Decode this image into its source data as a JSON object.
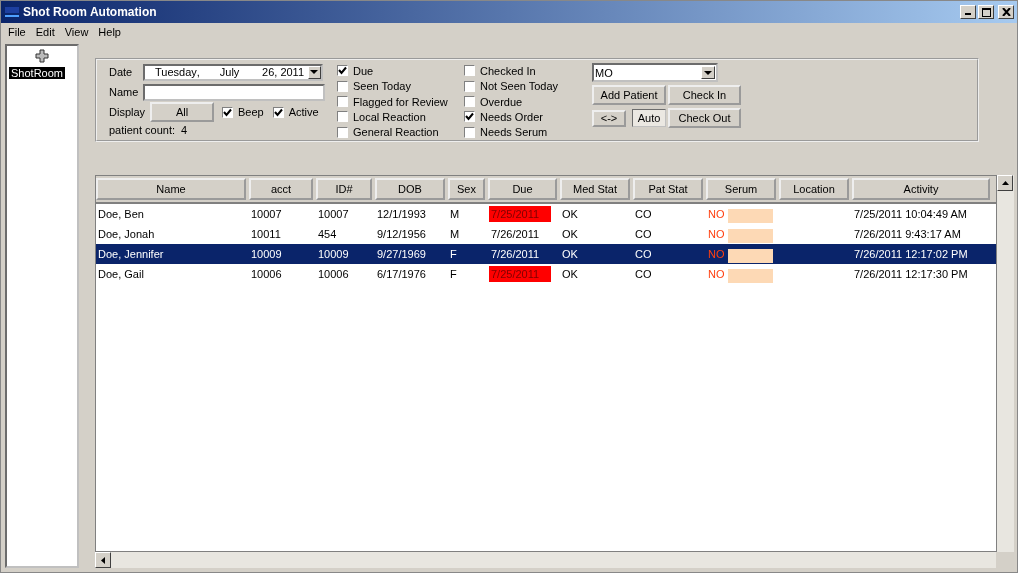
{
  "window": {
    "title": "Shot Room Automation"
  },
  "menu": [
    "File",
    "Edit",
    "View",
    "Help"
  ],
  "sidebar": {
    "items": [
      {
        "label": "ShotRoom",
        "selected": true
      }
    ]
  },
  "filters": {
    "date": {
      "label": "Date",
      "weekday": "Tuesday",
      "separator": ",",
      "month": "July",
      "day_year": "26, 2011"
    },
    "name": {
      "label": "Name"
    },
    "display": {
      "label": "Display",
      "button": "All"
    },
    "beep": {
      "label": "Beep",
      "checked": true
    },
    "active": {
      "label": "Active",
      "checked": true
    },
    "patient_count": {
      "label": "patient count:",
      "value": "4"
    },
    "checkbox_columns": [
      [
        {
          "label": "Due",
          "checked": true
        },
        {
          "label": "Seen Today",
          "checked": false
        },
        {
          "label": "Flagged for Review",
          "checked": false
        },
        {
          "label": "Local Reaction",
          "checked": false
        },
        {
          "label": "General Reaction",
          "checked": false
        }
      ],
      [
        {
          "label": "Checked In",
          "checked": false
        },
        {
          "label": "Not Seen Today",
          "checked": false
        },
        {
          "label": "Overdue",
          "checked": false
        },
        {
          "label": "Needs Order",
          "checked": true
        },
        {
          "label": "Needs Serum",
          "checked": false
        }
      ]
    ],
    "location_select": "MO",
    "buttons": {
      "add_patient": "Add Patient",
      "check_in": "Check In",
      "swap": "<->",
      "auto": "Auto",
      "check_out": "Check Out"
    }
  },
  "table": {
    "columns": [
      "Name",
      "acct",
      "ID#",
      "DOB",
      "Sex",
      "Due",
      "Med Stat",
      "Pat Stat",
      "Serum",
      "Location",
      "Activity"
    ],
    "rows": [
      {
        "name": "Doe, Ben",
        "acct": "10007",
        "id": "10007",
        "dob": "12/1/1993",
        "sex": "M",
        "due": "7/25/2011",
        "due_overdue": true,
        "med_stat": "OK",
        "pat_stat": "CO",
        "serum": "NO",
        "activity": "7/25/2011 10:04:49 AM",
        "selected": false
      },
      {
        "name": "Doe, Jonah",
        "acct": "10011",
        "id": "454",
        "dob": "9/12/1956",
        "sex": "M",
        "due": "7/26/2011",
        "due_overdue": false,
        "med_stat": "OK",
        "pat_stat": "CO",
        "serum": "NO",
        "activity": "7/26/2011 9:43:17 AM",
        "selected": false
      },
      {
        "name": "Doe, Jennifer",
        "acct": "10009",
        "id": "10009",
        "dob": "9/27/1969",
        "sex": "F",
        "due": "7/26/2011",
        "due_overdue": false,
        "med_stat": "OK",
        "pat_stat": "CO",
        "serum": "NO",
        "activity": "7/26/2011 12:17:02 PM",
        "selected": true
      },
      {
        "name": "Doe, Gail",
        "acct": "10006",
        "id": "10006",
        "dob": "6/17/1976",
        "sex": "F",
        "due": "7/25/2011",
        "due_overdue": true,
        "med_stat": "OK",
        "pat_stat": "CO",
        "serum": "NO",
        "activity": "7/26/2011 12:17:30 PM",
        "selected": false
      }
    ]
  }
}
